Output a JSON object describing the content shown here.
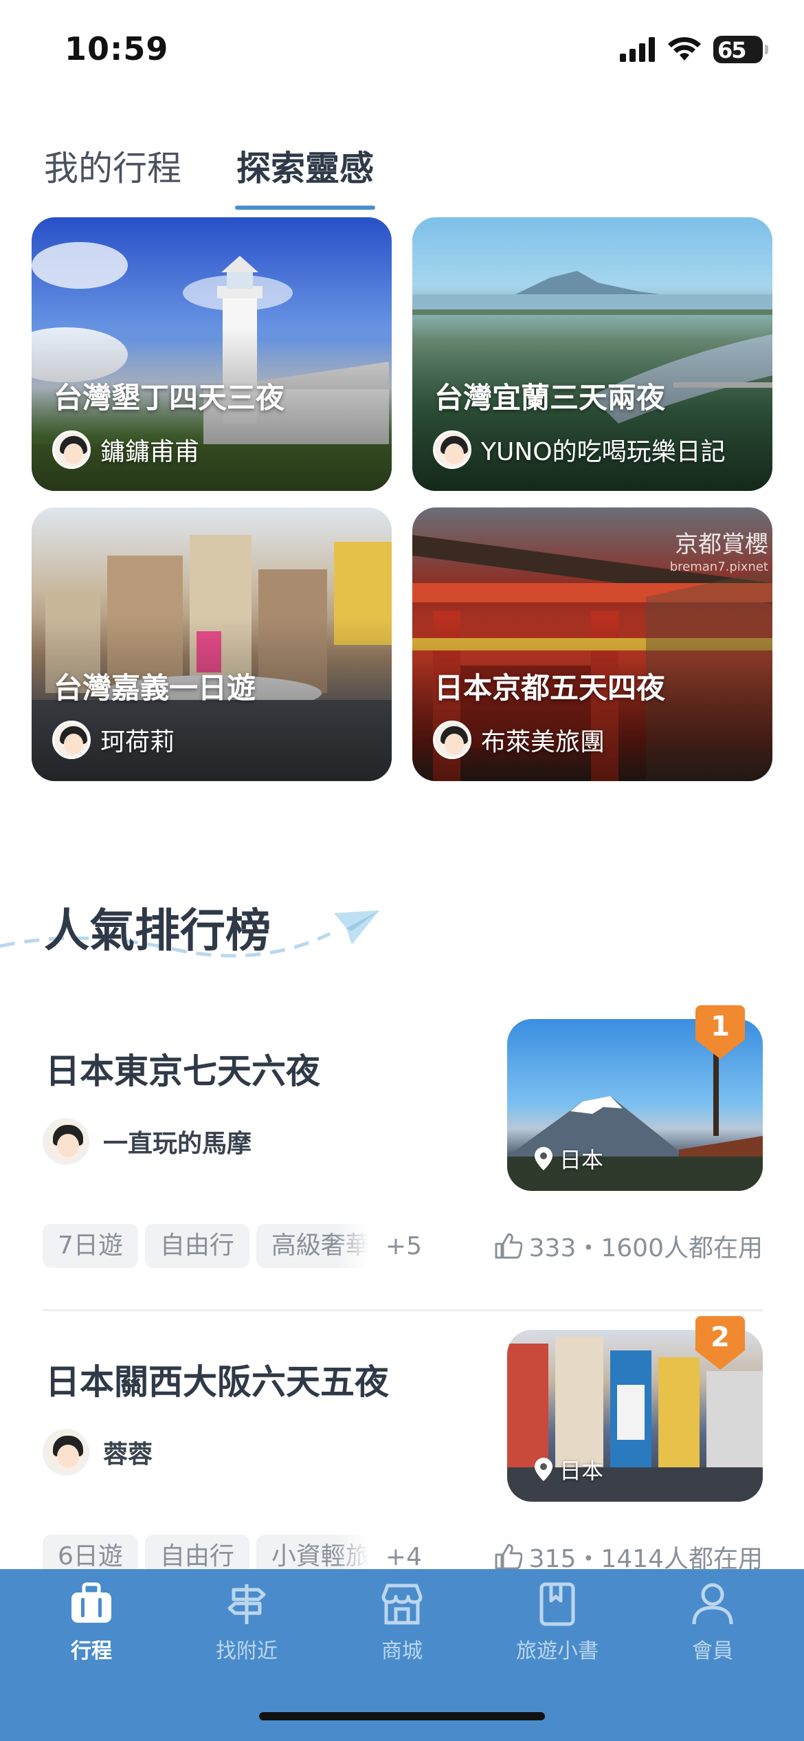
{
  "status_bar": {
    "time": "10:59",
    "battery": "65"
  },
  "tabs": [
    {
      "label": "我的行程",
      "active": false
    },
    {
      "label": "探索靈感",
      "active": true
    }
  ],
  "inspiration_cards": [
    {
      "title": "台灣墾丁四天三夜",
      "author": "鏞鏞甫甫"
    },
    {
      "title": "台灣宜蘭三天兩夜",
      "author": "YUNO的吃喝玩樂日記"
    },
    {
      "title": "台灣嘉義一日遊",
      "author": "珂荷莉"
    },
    {
      "title": "日本京都五天四夜",
      "author": "布萊美旅團",
      "watermark": "京都賞櫻",
      "watermark_sub": "breman7.pixnet"
    }
  ],
  "ranking": {
    "heading": "人氣排行榜",
    "entries": [
      {
        "rank": "1",
        "title": "日本東京七天六夜",
        "author": "一直玩的馬摩",
        "location": "日本",
        "tags": [
          "7日遊",
          "自由行",
          "高級奢華"
        ],
        "more": "+5",
        "stats": "333・1600人都在用"
      },
      {
        "rank": "2",
        "title": "日本關西大阪六天五夜",
        "author": "蓉蓉",
        "location": "日本",
        "tags": [
          "6日遊",
          "自由行",
          "小資輕旅"
        ],
        "more": "+4",
        "stats": "315・1414人都在用"
      }
    ]
  },
  "bottom_nav": [
    {
      "label": "行程",
      "icon": "suitcase-icon",
      "active": true
    },
    {
      "label": "找附近",
      "icon": "signpost-icon",
      "active": false
    },
    {
      "label": "商城",
      "icon": "store-icon",
      "active": false
    },
    {
      "label": "旅遊小書",
      "icon": "book-icon",
      "active": false
    },
    {
      "label": "會員",
      "icon": "person-icon",
      "active": false
    }
  ],
  "colors": {
    "accent": "#4a8ec9",
    "nav_bg": "#4a8ccb",
    "badge": "#f0892f"
  }
}
